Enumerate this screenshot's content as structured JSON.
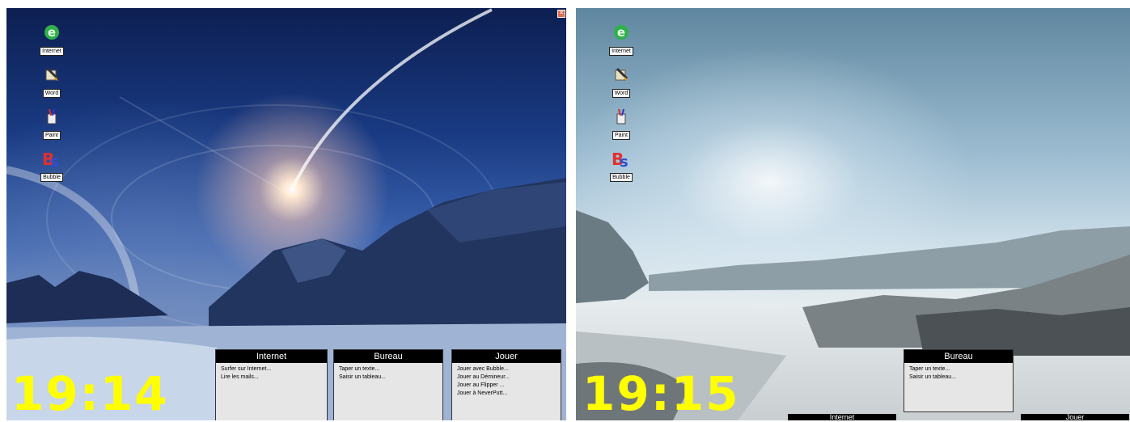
{
  "desktop_icons": [
    {
      "key": "internet",
      "label": "Internet"
    },
    {
      "key": "word",
      "label": "Word"
    },
    {
      "key": "paint",
      "label": "Paint"
    },
    {
      "key": "bubble",
      "label": "Bubble"
    }
  ],
  "left_screen": {
    "clock": "19:14",
    "menus": [
      {
        "title": "Internet",
        "items": [
          "Surfer sur Internet...",
          "Lire les mails..."
        ]
      },
      {
        "title": "Bureau",
        "items": [
          "Taper un texte...",
          "Saisir un tableau..."
        ]
      },
      {
        "title": "Jouer",
        "items": [
          "Jouer avec Bubble...",
          "Jouer au Démineur...",
          "Jouer au Flipper ...",
          "Jouer à NeverPutt..."
        ]
      }
    ]
  },
  "right_screen": {
    "clock": "19:15",
    "menus": [
      {
        "title": "Bureau",
        "items": [
          "Taper un texte...",
          "Saisir un tableau..."
        ]
      }
    ],
    "collapsed_tabs": [
      "Internet",
      "Jouer"
    ]
  },
  "colors": {
    "clock": "#ffff00",
    "menu_header": "#000000",
    "menu_body": "#e6e6e6"
  }
}
